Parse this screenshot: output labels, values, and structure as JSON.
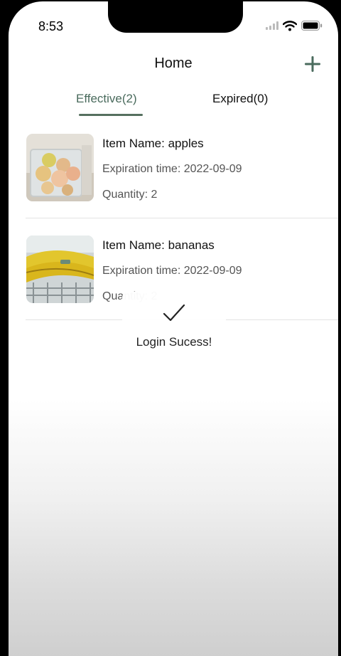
{
  "status_bar": {
    "time": "8:53"
  },
  "nav": {
    "title": "Home",
    "add_icon": "plus-icon"
  },
  "tabs": [
    {
      "label": "Effective(2)",
      "active": true
    },
    {
      "label": "Expired(0)",
      "active": false
    }
  ],
  "items": [
    {
      "name": "Item Name: apples",
      "expiration": "Expiration time: 2022-09-09",
      "quantity": "Quantity: 2",
      "image": "apples-photo"
    },
    {
      "name": "Item Name: bananas",
      "expiration": "Expiration time: 2022-09-09",
      "quantity": "Quantity: 2",
      "image": "bananas-photo"
    }
  ],
  "toast": {
    "message": "Login Sucess!",
    "icon": "checkmark-icon"
  },
  "colors": {
    "accent": "#4a6b5d",
    "indicator": "#56705f"
  }
}
